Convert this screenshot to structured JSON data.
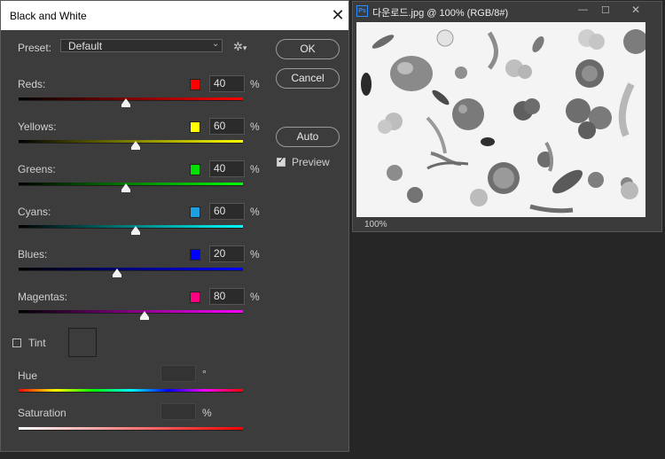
{
  "dialog": {
    "title": "Black and White",
    "close_label": "✕",
    "preset_label": "Preset:",
    "preset_value": "Default",
    "gear_icon": "gear-icon",
    "buttons": {
      "ok": "OK",
      "cancel": "Cancel",
      "auto": "Auto"
    },
    "preview_label": "Preview",
    "preview_checked": true,
    "sliders": [
      {
        "name": "Reds",
        "label": "Reds:",
        "value": "40",
        "unit": "%",
        "color": "#ff0000",
        "gradient": [
          "#000000",
          "#ff0000"
        ]
      },
      {
        "name": "Yellows",
        "label": "Yellows:",
        "value": "60",
        "unit": "%",
        "color": "#ffff00",
        "gradient": [
          "#000000",
          "#ffff00"
        ]
      },
      {
        "name": "Greens",
        "label": "Greens:",
        "value": "40",
        "unit": "%",
        "color": "#00e000",
        "gradient": [
          "#000000",
          "#00ff00"
        ]
      },
      {
        "name": "Cyans",
        "label": "Cyans:",
        "value": "60",
        "unit": "%",
        "color": "#1ea0e0",
        "gradient": [
          "#000000",
          "#00ffff"
        ]
      },
      {
        "name": "Blues",
        "label": "Blues:",
        "value": "20",
        "unit": "%",
        "color": "#0000ff",
        "gradient": [
          "#000000",
          "#0000ff"
        ]
      },
      {
        "name": "Magentas",
        "label": "Magentas:",
        "value": "80",
        "unit": "%",
        "color": "#ff0080",
        "gradient": [
          "#000000",
          "#ff00ff"
        ]
      }
    ],
    "tint": {
      "label": "Tint",
      "checked": false,
      "hue_label": "Hue",
      "hue_unit": "°",
      "hue_value": "",
      "saturation_label": "Saturation",
      "saturation_unit": "%",
      "saturation_value": ""
    }
  },
  "document": {
    "ps_badge": "Ps",
    "title": "다운로드.jpg @ 100% (RGB/8#)",
    "zoom": "100%",
    "window_controls": [
      "—",
      "☐",
      "✕"
    ]
  }
}
